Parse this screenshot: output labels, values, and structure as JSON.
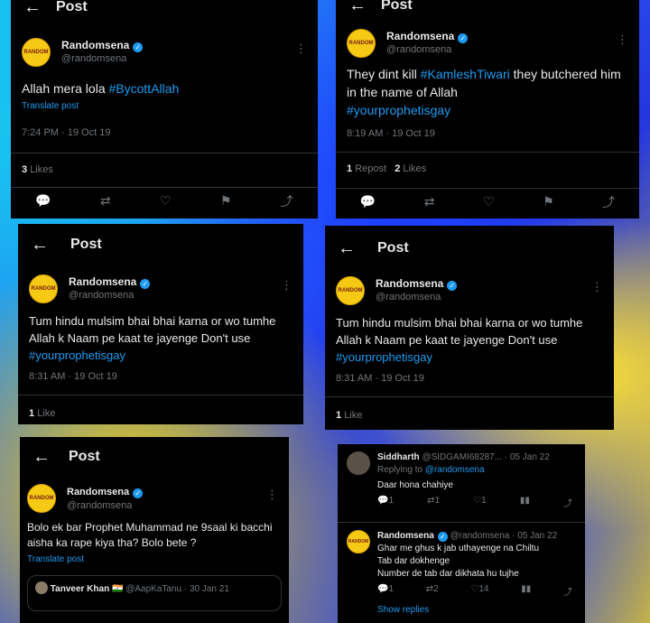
{
  "header_title": "Post",
  "author": {
    "name": "Randomsena",
    "handle": "@randomsena"
  },
  "translate_label": "Translate post",
  "show_replies": "Show replies",
  "posts": [
    {
      "body_text": "Allah mera lola ",
      "tags": [
        "#BycottAllah"
      ],
      "time": "7:24 PM · 19 Oct 19",
      "likes_count": "3",
      "likes_label": "Likes"
    },
    {
      "body_text": "They dint kill ",
      "inline_tag": "#KamleshTiwari",
      "body_text2": " they butchered him in the name of Allah",
      "tags": [
        "#yourprophetisgay"
      ],
      "time": "8:19 AM · 19 Oct 19",
      "reposts_count": "1",
      "reposts_label": "Repost",
      "likes_count": "2",
      "likes_label": "Likes"
    },
    {
      "body_text": "Tum hindu mulsim bhai bhai karna or wo tumhe Allah k Naam pe kaat te jayenge Don't use ",
      "tags": [
        "#yourprophetisgay"
      ],
      "time": "8:31 AM · 19 Oct 19",
      "likes_count": "1",
      "likes_label": "Like"
    },
    {
      "body_text": "Tum hindu mulsim bhai bhai karna or wo tumhe Allah k Naam pe kaat te jayenge Don't use ",
      "tags": [
        "#yourprophetisgay"
      ],
      "time": "8:31 AM · 19 Oct 19",
      "likes_count": "1",
      "likes_label": "Like"
    },
    {
      "body_text": "Bolo ek bar Prophet Muhammad ne 9saal ki bacchi aisha ka rape kiya tha? Bolo bete ?",
      "quoted": {
        "name": "Tanveer Khan",
        "flag": "🇮🇳",
        "handle": "@AapKaTanu",
        "date": "· 30 Jan 21"
      }
    }
  ],
  "replies": [
    {
      "name": "Siddharth",
      "handle": "@SIDGAMI68287...",
      "date": "· 05 Jan 22",
      "replying_prefix": "Replying to ",
      "replying_to": "@randomsena",
      "text": "Daar hona chahiye",
      "reply_count": "1",
      "repost_count": "1",
      "like_count": "1",
      "views_count": ""
    },
    {
      "name": "Randomsena",
      "handle": "@randomsena",
      "date": "· 05 Jan 22",
      "text_lines": [
        "Ghar me ghus k jab uthayenge na Chiltu",
        "Tab dar dokhenge",
        "Number de tab dar dikhata hu tujhe"
      ],
      "reply_count": "1",
      "repost_count": "2",
      "like_count": "14",
      "views_count": ""
    }
  ]
}
